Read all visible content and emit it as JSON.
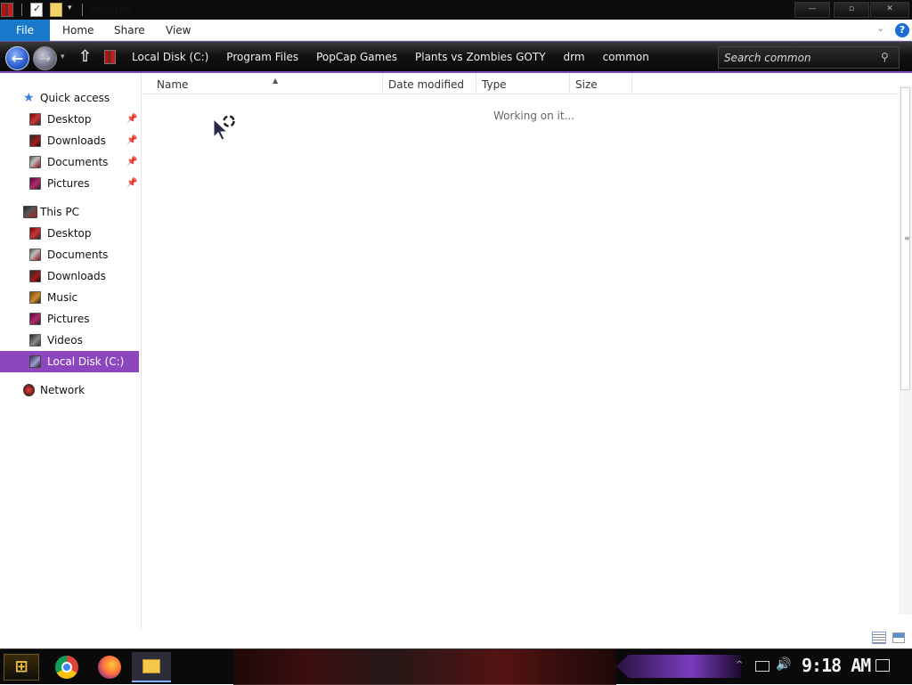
{
  "titlebar": {
    "title": "images",
    "dropdown_glyph": "▾",
    "minimize_glyph": "—",
    "maximize_glyph": "▫",
    "close_glyph": "✕"
  },
  "ribbon": {
    "tabs": [
      {
        "label": "File"
      },
      {
        "label": "Home"
      },
      {
        "label": "Share"
      },
      {
        "label": "View"
      }
    ],
    "expand_glyph": "⌄",
    "help_glyph": "?"
  },
  "navbar": {
    "back_glyph": "←",
    "forward_glyph": "→",
    "recent_glyph": "▾",
    "up_glyph": "⇧",
    "breadcrumb": [
      "Local Disk (C:)",
      "Program Files",
      "PopCap Games",
      "Plants vs Zombies GOTY",
      "drm",
      "common"
    ],
    "search": {
      "placeholder": "Search common",
      "value": ""
    },
    "search_glyph": "⚲"
  },
  "sidebar": {
    "quick_access": {
      "label": "Quick access",
      "icon": "star-icon",
      "glyph": "★"
    },
    "quick_items": [
      {
        "label": "Desktop",
        "icon": "desktop-icon",
        "pinned": true
      },
      {
        "label": "Downloads",
        "icon": "downloads-icon",
        "pinned": true
      },
      {
        "label": "Documents",
        "icon": "documents-icon",
        "pinned": true
      },
      {
        "label": "Pictures",
        "icon": "pictures-icon",
        "pinned": true
      }
    ],
    "pin_glyph": "📌",
    "this_pc": {
      "label": "This PC",
      "icon": "computer-icon"
    },
    "pc_items": [
      {
        "label": "Desktop",
        "icon": "desktop-icon"
      },
      {
        "label": "Documents",
        "icon": "documents-icon"
      },
      {
        "label": "Downloads",
        "icon": "downloads-icon"
      },
      {
        "label": "Music",
        "icon": "music-icon"
      },
      {
        "label": "Pictures",
        "icon": "pictures-icon"
      },
      {
        "label": "Videos",
        "icon": "videos-icon"
      },
      {
        "label": "Local Disk (C:)",
        "icon": "disk-icon",
        "selected": true
      }
    ],
    "network": {
      "label": "Network",
      "icon": "network-icon"
    }
  },
  "content": {
    "columns": [
      "Name",
      "Date modified",
      "Type",
      "Size"
    ],
    "sort_glyph": "▲",
    "status_text": "Working on it..."
  },
  "scrollbar": {
    "grip_glyph": "≡"
  },
  "taskbar": {
    "start_glyph": "⊞",
    "pinned": [
      "chrome-icon",
      "firefox-icon",
      "file-explorer-icon"
    ],
    "tray_arrow_glyph": "^",
    "volume_glyph": "🔊",
    "clock": "9:18 AM"
  },
  "colors": {
    "accent": "#1979ca",
    "selection": "#8c47bf",
    "navbar_border": "#7d4fc4"
  }
}
